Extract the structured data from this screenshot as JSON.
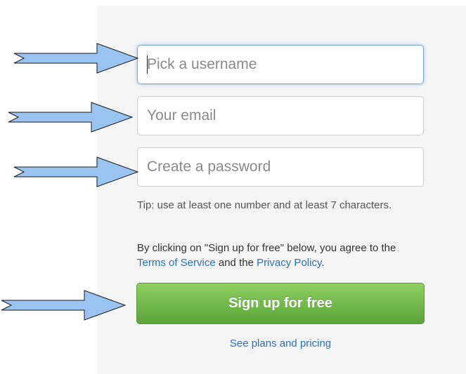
{
  "form": {
    "username_placeholder": "Pick a username",
    "email_placeholder": "Your email",
    "password_placeholder": "Create a password",
    "tip_text": "Tip: use at least one number and at least 7 characters.",
    "terms_prefix": "By clicking on \"Sign up for free\" below, you agree to the ",
    "terms_link": "Terms of Service",
    "terms_middle": " and the ",
    "privacy_link": "Privacy Policy",
    "terms_suffix": ".",
    "signup_label": "Sign up for free",
    "plans_link": "See plans and pricing"
  },
  "colors": {
    "arrow_fill": "#99c4f2",
    "signup_green": "#6ab446",
    "link_blue": "#2a6fbf",
    "focus_blue": "#7ea8d8"
  },
  "annotations": {
    "arrow_icon": "right-arrow-icon"
  }
}
